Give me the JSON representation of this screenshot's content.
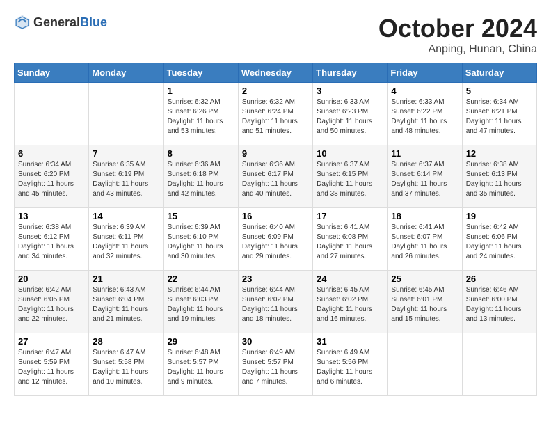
{
  "header": {
    "logo_general": "General",
    "logo_blue": "Blue",
    "month": "October 2024",
    "location": "Anping, Hunan, China"
  },
  "weekdays": [
    "Sunday",
    "Monday",
    "Tuesday",
    "Wednesday",
    "Thursday",
    "Friday",
    "Saturday"
  ],
  "weeks": [
    [
      {
        "day": "",
        "info": ""
      },
      {
        "day": "",
        "info": ""
      },
      {
        "day": "1",
        "sunrise": "6:32 AM",
        "sunset": "6:26 PM",
        "daylight": "11 hours and 53 minutes."
      },
      {
        "day": "2",
        "sunrise": "6:32 AM",
        "sunset": "6:24 PM",
        "daylight": "11 hours and 51 minutes."
      },
      {
        "day": "3",
        "sunrise": "6:33 AM",
        "sunset": "6:23 PM",
        "daylight": "11 hours and 50 minutes."
      },
      {
        "day": "4",
        "sunrise": "6:33 AM",
        "sunset": "6:22 PM",
        "daylight": "11 hours and 48 minutes."
      },
      {
        "day": "5",
        "sunrise": "6:34 AM",
        "sunset": "6:21 PM",
        "daylight": "11 hours and 47 minutes."
      }
    ],
    [
      {
        "day": "6",
        "sunrise": "6:34 AM",
        "sunset": "6:20 PM",
        "daylight": "11 hours and 45 minutes."
      },
      {
        "day": "7",
        "sunrise": "6:35 AM",
        "sunset": "6:19 PM",
        "daylight": "11 hours and 43 minutes."
      },
      {
        "day": "8",
        "sunrise": "6:36 AM",
        "sunset": "6:18 PM",
        "daylight": "11 hours and 42 minutes."
      },
      {
        "day": "9",
        "sunrise": "6:36 AM",
        "sunset": "6:17 PM",
        "daylight": "11 hours and 40 minutes."
      },
      {
        "day": "10",
        "sunrise": "6:37 AM",
        "sunset": "6:15 PM",
        "daylight": "11 hours and 38 minutes."
      },
      {
        "day": "11",
        "sunrise": "6:37 AM",
        "sunset": "6:14 PM",
        "daylight": "11 hours and 37 minutes."
      },
      {
        "day": "12",
        "sunrise": "6:38 AM",
        "sunset": "6:13 PM",
        "daylight": "11 hours and 35 minutes."
      }
    ],
    [
      {
        "day": "13",
        "sunrise": "6:38 AM",
        "sunset": "6:12 PM",
        "daylight": "11 hours and 34 minutes."
      },
      {
        "day": "14",
        "sunrise": "6:39 AM",
        "sunset": "6:11 PM",
        "daylight": "11 hours and 32 minutes."
      },
      {
        "day": "15",
        "sunrise": "6:39 AM",
        "sunset": "6:10 PM",
        "daylight": "11 hours and 30 minutes."
      },
      {
        "day": "16",
        "sunrise": "6:40 AM",
        "sunset": "6:09 PM",
        "daylight": "11 hours and 29 minutes."
      },
      {
        "day": "17",
        "sunrise": "6:41 AM",
        "sunset": "6:08 PM",
        "daylight": "11 hours and 27 minutes."
      },
      {
        "day": "18",
        "sunrise": "6:41 AM",
        "sunset": "6:07 PM",
        "daylight": "11 hours and 26 minutes."
      },
      {
        "day": "19",
        "sunrise": "6:42 AM",
        "sunset": "6:06 PM",
        "daylight": "11 hours and 24 minutes."
      }
    ],
    [
      {
        "day": "20",
        "sunrise": "6:42 AM",
        "sunset": "6:05 PM",
        "daylight": "11 hours and 22 minutes."
      },
      {
        "day": "21",
        "sunrise": "6:43 AM",
        "sunset": "6:04 PM",
        "daylight": "11 hours and 21 minutes."
      },
      {
        "day": "22",
        "sunrise": "6:44 AM",
        "sunset": "6:03 PM",
        "daylight": "11 hours and 19 minutes."
      },
      {
        "day": "23",
        "sunrise": "6:44 AM",
        "sunset": "6:02 PM",
        "daylight": "11 hours and 18 minutes."
      },
      {
        "day": "24",
        "sunrise": "6:45 AM",
        "sunset": "6:02 PM",
        "daylight": "11 hours and 16 minutes."
      },
      {
        "day": "25",
        "sunrise": "6:45 AM",
        "sunset": "6:01 PM",
        "daylight": "11 hours and 15 minutes."
      },
      {
        "day": "26",
        "sunrise": "6:46 AM",
        "sunset": "6:00 PM",
        "daylight": "11 hours and 13 minutes."
      }
    ],
    [
      {
        "day": "27",
        "sunrise": "6:47 AM",
        "sunset": "5:59 PM",
        "daylight": "11 hours and 12 minutes."
      },
      {
        "day": "28",
        "sunrise": "6:47 AM",
        "sunset": "5:58 PM",
        "daylight": "11 hours and 10 minutes."
      },
      {
        "day": "29",
        "sunrise": "6:48 AM",
        "sunset": "5:57 PM",
        "daylight": "11 hours and 9 minutes."
      },
      {
        "day": "30",
        "sunrise": "6:49 AM",
        "sunset": "5:57 PM",
        "daylight": "11 hours and 7 minutes."
      },
      {
        "day": "31",
        "sunrise": "6:49 AM",
        "sunset": "5:56 PM",
        "daylight": "11 hours and 6 minutes."
      },
      {
        "day": "",
        "info": ""
      },
      {
        "day": "",
        "info": ""
      }
    ]
  ]
}
